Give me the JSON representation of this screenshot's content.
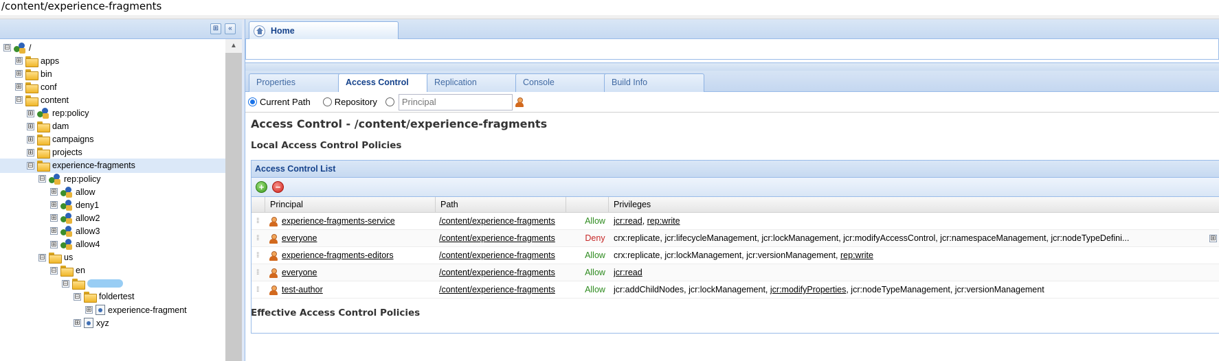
{
  "path_bar": "/content/experience-fragments",
  "left_panel": {
    "scroll_up_glyph": "▲",
    "header_buttons": [
      {
        "icon": "binoculars-icon",
        "glyph": "⊞"
      },
      {
        "icon": "collapse-left-icon",
        "glyph": "«"
      }
    ],
    "tree": [
      {
        "label": "/",
        "icon": "policy",
        "toggle": "⊟",
        "level": 0
      },
      {
        "label": "apps",
        "icon": "folder",
        "toggle": "⊞",
        "level": 1
      },
      {
        "label": "bin",
        "icon": "folder",
        "toggle": "⊞",
        "level": 1
      },
      {
        "label": "conf",
        "icon": "folder",
        "toggle": "⊞",
        "level": 1
      },
      {
        "label": "content",
        "icon": "folder",
        "toggle": "⊟",
        "level": 1
      },
      {
        "label": "rep:policy",
        "icon": "policy",
        "toggle": "⊞",
        "level": 2
      },
      {
        "label": "dam",
        "icon": "folder",
        "toggle": "⊞",
        "level": 2
      },
      {
        "label": "campaigns",
        "icon": "folder",
        "toggle": "⊞",
        "level": 2
      },
      {
        "label": "projects",
        "icon": "folder",
        "toggle": "⊞",
        "level": 2
      },
      {
        "label": "experience-fragments",
        "icon": "folder",
        "toggle": "⊟",
        "level": 2,
        "selected": true
      },
      {
        "label": "rep:policy",
        "icon": "policy",
        "toggle": "⊟",
        "level": 3
      },
      {
        "label": "allow",
        "icon": "policy",
        "toggle": "⊞",
        "level": 4
      },
      {
        "label": "deny1",
        "icon": "policy",
        "toggle": "⊞",
        "level": 4
      },
      {
        "label": "allow2",
        "icon": "policy",
        "toggle": "⊞",
        "level": 4
      },
      {
        "label": "allow3",
        "icon": "policy",
        "toggle": "⊞",
        "level": 4
      },
      {
        "label": "allow4",
        "icon": "policy",
        "toggle": "⊞",
        "level": 4
      },
      {
        "label": "us",
        "icon": "folder",
        "toggle": "⊟",
        "level": 3
      },
      {
        "label": "en",
        "icon": "folder",
        "toggle": "⊟",
        "level": 4
      },
      {
        "label": "",
        "icon": "folder",
        "toggle": "⊟",
        "level": 5,
        "blurred": true
      },
      {
        "label": "foldertest",
        "icon": "folder",
        "toggle": "⊟",
        "level": 6
      },
      {
        "label": "experience-fragment",
        "icon": "page",
        "toggle": "⊞",
        "level": 7
      },
      {
        "label": "xyz",
        "icon": "page",
        "toggle": "⊞",
        "level": 6
      }
    ]
  },
  "main_tab": {
    "label": "Home"
  },
  "sub_tabs": [
    {
      "label": "Properties",
      "active": false
    },
    {
      "label": "Access Control",
      "active": true
    },
    {
      "label": "Replication",
      "active": false
    },
    {
      "label": "Console",
      "active": false
    },
    {
      "label": "Build Info",
      "active": false
    }
  ],
  "filter": {
    "current_path_label": "Current Path",
    "repository_label": "Repository",
    "principal_placeholder": "Principal",
    "selected": "current_path"
  },
  "access_control_title": "Access Control - /content/experience-fragments",
  "local_policies_title": "Local Access Control Policies",
  "acl": {
    "title": "Access Control List",
    "toolbar": {
      "add_glyph": "+",
      "remove_glyph": "−"
    },
    "columns": {
      "principal": "Principal",
      "path": "Path",
      "effect": "",
      "privileges": "Privileges"
    },
    "rows": [
      {
        "principal": "experience-fragments-service",
        "path": "/content/experience-fragments",
        "effect": "Allow",
        "privileges": [
          {
            "text": "jcr:read",
            "link": true
          },
          {
            "text": ", ",
            "link": false
          },
          {
            "text": "rep:write",
            "link": true
          }
        ]
      },
      {
        "principal": "everyone",
        "path": "/content/experience-fragments",
        "effect": "Deny",
        "privileges": [
          {
            "text": "crx:replicate, jcr:lifecycleManagement, jcr:lockManagement, jcr:modifyAccessControl, jcr:namespaceManagement, jcr:nodeTypeDefini...",
            "link": false
          }
        ],
        "expander": "⊞"
      },
      {
        "principal": "experience-fragments-editors",
        "path": "/content/experience-fragments",
        "effect": "Allow",
        "privileges": [
          {
            "text": "crx:replicate, jcr:lockManagement, jcr:versionManagement, ",
            "link": false
          },
          {
            "text": "rep:write",
            "link": true
          }
        ]
      },
      {
        "principal": "everyone",
        "path": "/content/experience-fragments",
        "effect": "Allow",
        "privileges": [
          {
            "text": "jcr:read",
            "link": true
          }
        ]
      },
      {
        "principal": "test-author",
        "path": "/content/experience-fragments",
        "effect": "Allow",
        "privileges": [
          {
            "text": "jcr:addChildNodes, jcr:lockManagement, ",
            "link": false
          },
          {
            "text": "jcr:modifyProperties",
            "link": true
          },
          {
            "text": ", jcr:nodeTypeManagement, jcr:versionManagement",
            "link": false
          }
        ]
      }
    ],
    "drag_glyph": "⁞⁞"
  },
  "effective_policies_title": "Effective Access Control Policies",
  "colors": {
    "accent": "#15428b",
    "allow": "#2e8b1f",
    "deny": "#c62828",
    "panel_border": "#99bbe8"
  }
}
